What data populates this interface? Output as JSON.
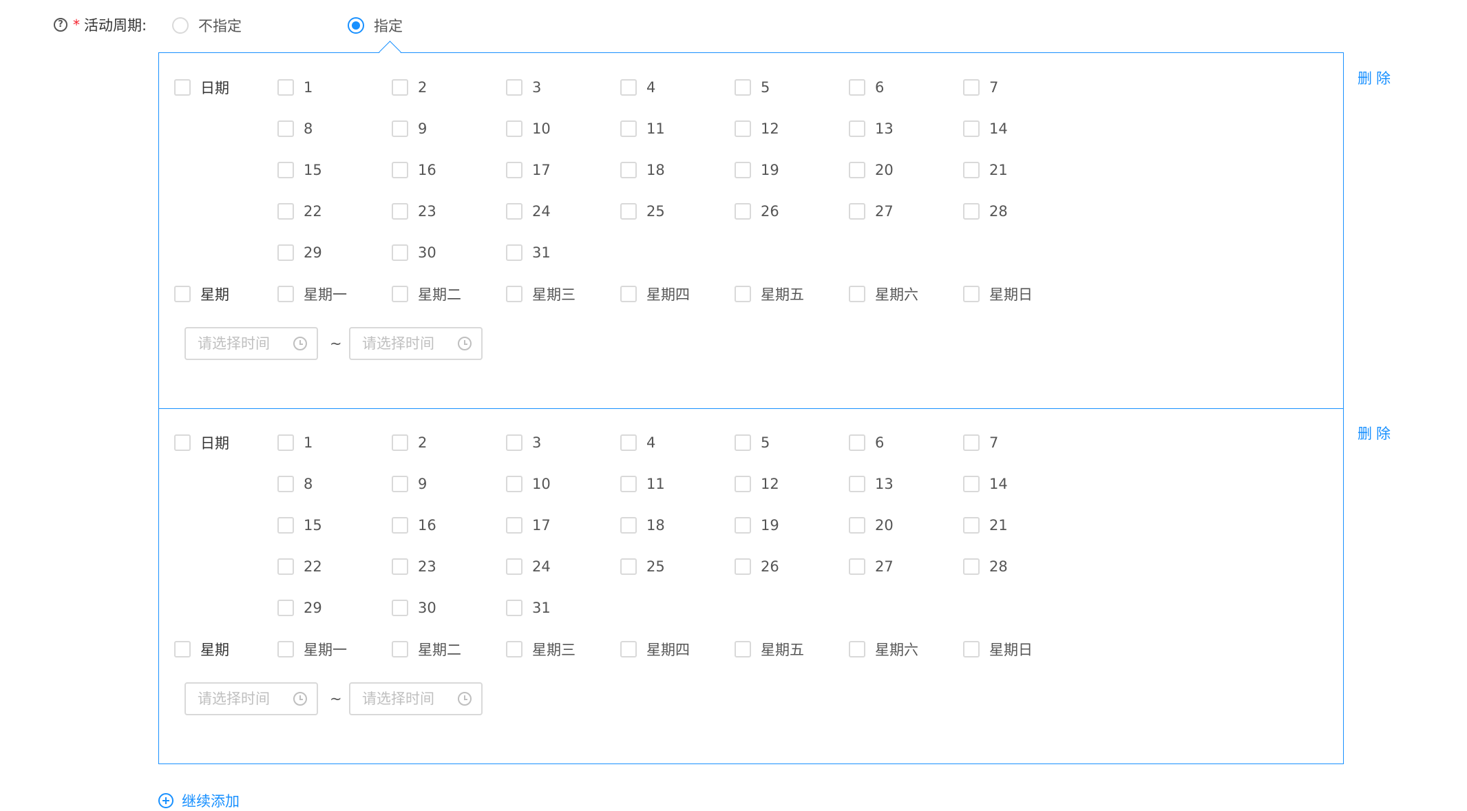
{
  "field": {
    "label": "活动周期:",
    "required_mark": "*",
    "help_icon_glyph": "?",
    "options": [
      {
        "label": "不指定",
        "checked": false
      },
      {
        "label": "指定",
        "checked": true
      }
    ]
  },
  "rules": [
    {
      "date_label": "日期",
      "days": [
        "1",
        "2",
        "3",
        "4",
        "5",
        "6",
        "7",
        "8",
        "9",
        "10",
        "11",
        "12",
        "13",
        "14",
        "15",
        "16",
        "17",
        "18",
        "19",
        "20",
        "21",
        "22",
        "23",
        "24",
        "25",
        "26",
        "27",
        "28",
        "29",
        "30",
        "31"
      ],
      "week_label": "星期",
      "weekdays": [
        "星期一",
        "星期二",
        "星期三",
        "星期四",
        "星期五",
        "星期六",
        "星期日"
      ],
      "start_placeholder": "请选择时间",
      "end_placeholder": "请选择时间",
      "separator": "~",
      "delete_label": "删除"
    },
    {
      "date_label": "日期",
      "days": [
        "1",
        "2",
        "3",
        "4",
        "5",
        "6",
        "7",
        "8",
        "9",
        "10",
        "11",
        "12",
        "13",
        "14",
        "15",
        "16",
        "17",
        "18",
        "19",
        "20",
        "21",
        "22",
        "23",
        "24",
        "25",
        "26",
        "27",
        "28",
        "29",
        "30",
        "31"
      ],
      "week_label": "星期",
      "weekdays": [
        "星期一",
        "星期二",
        "星期三",
        "星期四",
        "星期五",
        "星期六",
        "星期日"
      ],
      "start_placeholder": "请选择时间",
      "end_placeholder": "请选择时间",
      "separator": "~",
      "delete_label": "删除"
    }
  ],
  "add_more_label": "继续添加",
  "icons": {
    "help": "question-circle-icon",
    "clock": "clock-icon",
    "add": "plus-circle-icon"
  },
  "colors": {
    "accent": "#1890ff",
    "required": "#f5222d",
    "border": "#d9d9d9",
    "placeholder": "#bfbfbf"
  }
}
